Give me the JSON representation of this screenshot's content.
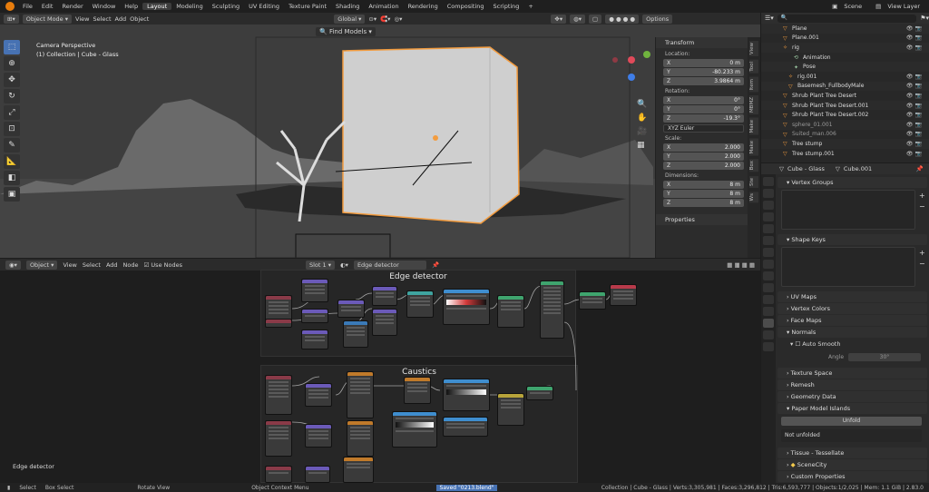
{
  "topbar": {
    "menus": [
      "File",
      "Edit",
      "Render",
      "Window",
      "Help"
    ],
    "workspaces": [
      "Layout",
      "Modeling",
      "Sculpting",
      "UV Editing",
      "Texture Paint",
      "Shading",
      "Animation",
      "Rendering",
      "Compositing",
      "Scripting"
    ],
    "active_workspace": "Layout",
    "scene": "Scene",
    "view_layer": "View Layer"
  },
  "viewport": {
    "mode": "Object Mode",
    "menus": [
      "View",
      "Select",
      "Add",
      "Object"
    ],
    "orientation": "Global",
    "find_models": "Find Models",
    "options": "Options",
    "overlay_title": "Camera Perspective",
    "overlay_sub": "(1) Collection | Cube - Glass",
    "bottom_label": "Edge detector"
  },
  "transform": {
    "title": "Transform",
    "location_label": "Location:",
    "location": {
      "x": "0 m",
      "y": "-80.233 m",
      "z": "3.9864 m"
    },
    "rotation_label": "Rotation:",
    "rotation": {
      "x": "0°",
      "y": "0°",
      "z": "-19.3°"
    },
    "rotation_mode": "XYZ Euler",
    "scale_label": "Scale:",
    "scale": {
      "x": "2.000",
      "y": "2.000",
      "z": "2.000"
    },
    "dimensions_label": "Dimensions:",
    "dimensions": {
      "x": "8 m",
      "y": "8 m",
      "z": "8 m"
    },
    "properties": "Properties"
  },
  "sidebar_tabs": [
    "Box",
    "Blk",
    "Ws",
    "Ste",
    "Box",
    "Make",
    "Make",
    "MBMZ",
    "Item",
    "Tool",
    "View"
  ],
  "node_editor": {
    "type": "Object",
    "menus": [
      "View",
      "Select",
      "Add",
      "Node"
    ],
    "use_nodes": "Use Nodes",
    "slot": "Slot 1",
    "material": "Edge detector",
    "frame1": "Edge detector",
    "frame2": "Caustics"
  },
  "outliner": {
    "rows": [
      {
        "name": "Plane",
        "color": "#f39c3f"
      },
      {
        "name": "Plane.001",
        "color": "#f39c3f"
      },
      {
        "name": "rig",
        "color": "#f39c3f"
      },
      {
        "name": "Animation",
        "color": "#9bc8a1"
      },
      {
        "name": "Pose",
        "color": "#9bc8a1"
      },
      {
        "name": "rig.001",
        "color": "#f39c3f"
      },
      {
        "name": "Basemesh_FullbodyMale",
        "color": "#f39c3f"
      },
      {
        "name": "Shrub Plant Tree Desert",
        "color": "#f39c3f"
      },
      {
        "name": "Shrub Plant Tree Desert.001",
        "color": "#f39c3f"
      },
      {
        "name": "Shrub Plant Tree Desert.002",
        "color": "#f39c3f"
      },
      {
        "name": "sphere_01.001",
        "color": "#f39c3f"
      },
      {
        "name": "Suited_man.006",
        "color": "#f39c3f"
      },
      {
        "name": "Tree stump",
        "color": "#f39c3f"
      },
      {
        "name": "Tree stump.001",
        "color": "#f39c3f"
      }
    ]
  },
  "properties": {
    "object": "Cube - Glass",
    "data": "Cube.001",
    "vertex_groups": "Vertex Groups",
    "shape_keys": "Shape Keys",
    "uv_maps": "UV Maps",
    "vertex_colors": "Vertex Colors",
    "face_maps": "Face Maps",
    "normals": "Normals",
    "auto_smooth": "Auto Smooth",
    "angle_label": "Angle",
    "angle": "30°",
    "texture_space": "Texture Space",
    "remesh": "Remesh",
    "geometry_data": "Geometry Data",
    "paper_model": "Paper Model Islands",
    "unfolded": "Unfold",
    "not_unfolded": "Not unfolded",
    "tissue": "Tissue - Tessellate",
    "scenecity": "SceneCity",
    "custom_props": "Custom Properties"
  },
  "statusbar": {
    "select": "Select",
    "box_select": "Box Select",
    "rotate_view": "Rotate View",
    "context_menu": "Object Context Menu",
    "saved": "Saved \"0213.blend\"",
    "stats": "Collection | Cube - Glass | Verts:3,305,981 | Faces:3,296,812 | Tris:6,593,777 | Objects:1/2,025 | Mem: 1.1 GiB | 2.83.0"
  },
  "colors": {
    "accent": "#4772b3",
    "selection": "#f39c3f",
    "brand": "#e87d0d"
  }
}
